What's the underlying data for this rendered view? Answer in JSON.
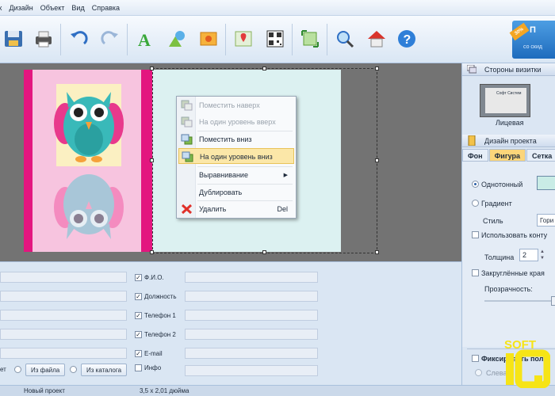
{
  "menu": [
    "х",
    "Дизайн",
    "Объект",
    "Вид",
    "Справка"
  ],
  "promo": {
    "badge": "30%",
    "title": "П",
    "subtitle": "со скид"
  },
  "context_menu": {
    "items": [
      {
        "label": "Поместить наверх",
        "enabled": false,
        "icon": "bring-to-front-icon"
      },
      {
        "label": "На один уровень вверх",
        "enabled": false,
        "icon": "bring-forward-icon"
      },
      {
        "label": "Поместить вниз",
        "enabled": true,
        "icon": "send-to-back-icon"
      },
      {
        "label": "На один уровень вниз",
        "enabled": true,
        "highlighted": true,
        "icon": "send-backward-icon"
      },
      {
        "label": "Выравнивание",
        "enabled": true,
        "submenu": true
      },
      {
        "label": "Дублировать",
        "enabled": true
      },
      {
        "label": "Удалить",
        "enabled": true,
        "shortcut": "Del",
        "icon": "delete-icon"
      }
    ]
  },
  "right_panel": {
    "sides_title": "Стороны визитки",
    "thumb_text": "Софт Систем",
    "thumb_label": "Лицевая",
    "design_title": "Дизайн проекта",
    "tabs": [
      "Фон",
      "Фигура",
      "Сетка"
    ],
    "active_tab": "Фигура",
    "fill_solid": "Однотонный",
    "fill_gradient": "Градиент",
    "style_label": "Стиль",
    "style_value": "Гори",
    "use_outline": "Использовать конту",
    "thickness_label": "Толщина",
    "thickness_value": "2",
    "rounded": "Закруглённые края",
    "opacity_label": "Прозрачность:",
    "fix_position": "Фиксировать поло",
    "align_left": "Слева"
  },
  "form": {
    "fields": [
      {
        "label": "Ф.И.О.",
        "checked": true
      },
      {
        "label": "Должность",
        "checked": true
      },
      {
        "label": "Телефон 1",
        "checked": true
      },
      {
        "label": "Телефон 2",
        "checked": true
      },
      {
        "label": "E-mail",
        "checked": true
      },
      {
        "label": "Инфо",
        "checked": false
      }
    ],
    "left_partial": "ет",
    "from_file": "Из файла",
    "from_catalog": "Из каталога"
  },
  "status": {
    "project": "Новый проект",
    "size": "3,5 x 2,01 дюйма"
  },
  "watermark": "SOFT",
  "colors": {
    "pink": "#e3167f",
    "card_bg": "#f7c4df",
    "right_card": "#dcf1f1",
    "highlight": "#fbe7a8"
  }
}
